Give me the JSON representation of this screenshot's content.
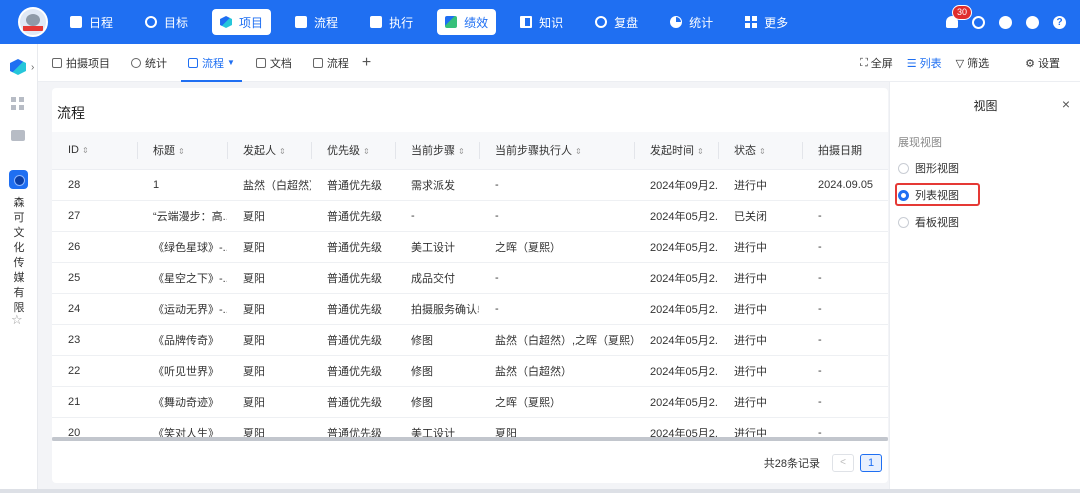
{
  "topnav": {
    "items": [
      {
        "label": "日程",
        "icon": "calendar-icon"
      },
      {
        "label": "目标",
        "icon": "target-icon"
      },
      {
        "label": "项目",
        "icon": "cube-icon",
        "active": true
      },
      {
        "label": "流程",
        "icon": "flow-icon"
      },
      {
        "label": "执行",
        "icon": "execute-icon"
      },
      {
        "label": "绩效",
        "icon": "performance-icon",
        "active": true
      },
      {
        "label": "知识",
        "icon": "book-icon"
      },
      {
        "label": "复盘",
        "icon": "review-icon"
      },
      {
        "label": "统计",
        "icon": "pie-icon"
      },
      {
        "label": "更多",
        "icon": "grid-icon"
      }
    ],
    "notification_count": "30",
    "help_glyph": "?"
  },
  "rail": {
    "org_name": "森可文化传媒有限"
  },
  "subnav": {
    "tabs": [
      {
        "label": "拍摄项目"
      },
      {
        "label": "统计"
      },
      {
        "label": "流程",
        "active": true
      },
      {
        "label": "文档"
      },
      {
        "label": "流程"
      }
    ],
    "add_label": "+",
    "fullscreen_label": "全屏",
    "list_label": "列表",
    "filter_label": "筛选",
    "settings_label": "设置"
  },
  "main": {
    "title": "流程",
    "columns": [
      "ID",
      "标题",
      "发起人",
      "优先级",
      "当前步骤",
      "当前步骤执行人",
      "发起时间",
      "状态",
      "拍摄日期"
    ],
    "rows": [
      [
        "28",
        "1",
        "盐然（白超然）",
        "普通优先级",
        "需求派发",
        "-",
        "2024年09月2...",
        "进行中",
        "2024.09.05"
      ],
      [
        "27",
        "“云端漫步：高...",
        "夏阳",
        "普通优先级",
        "-",
        "-",
        "2024年05月2...",
        "已关闭",
        "-"
      ],
      [
        "26",
        "《绿色星球》-...",
        "夏阳",
        "普通优先级",
        "美工设计",
        "之晖（夏熙）",
        "2024年05月2...",
        "进行中",
        "-"
      ],
      [
        "25",
        "《星空之下》-...",
        "夏阳",
        "普通优先级",
        "成品交付",
        "-",
        "2024年05月2...",
        "进行中",
        "-"
      ],
      [
        "24",
        "《运动无界》-...",
        "夏阳",
        "普通优先级",
        "拍摄服务确认单",
        "-",
        "2024年05月2...",
        "进行中",
        "-"
      ],
      [
        "23",
        "《品牌传奇》",
        "夏阳",
        "普通优先级",
        "修图",
        "盐然（白超然）,之晖（夏熙）",
        "2024年05月2...",
        "进行中",
        "-"
      ],
      [
        "22",
        "《听见世界》",
        "夏阳",
        "普通优先级",
        "修图",
        "盐然（白超然）",
        "2024年05月2...",
        "进行中",
        "-"
      ],
      [
        "21",
        "《舞动奇迹》",
        "夏阳",
        "普通优先级",
        "修图",
        "之晖（夏熙）",
        "2024年05月2...",
        "进行中",
        "-"
      ],
      [
        "20",
        "《笑对人生》",
        "夏阳",
        "普通优先级",
        "美工设计",
        "夏阳",
        "2024年05月2...",
        "进行中",
        "-"
      ]
    ],
    "total_text": "共28条记录",
    "prev_glyph": "<",
    "current_page": "1"
  },
  "drawer": {
    "title": "视图",
    "close_glyph": "×",
    "section_label": "展现视图",
    "options": [
      {
        "label": "图形视图",
        "selected": false
      },
      {
        "label": "列表视图",
        "selected": true
      },
      {
        "label": "看板视图",
        "selected": false
      }
    ]
  },
  "colors": {
    "brand": "#1f6ff2",
    "highlight": "#e53935"
  }
}
